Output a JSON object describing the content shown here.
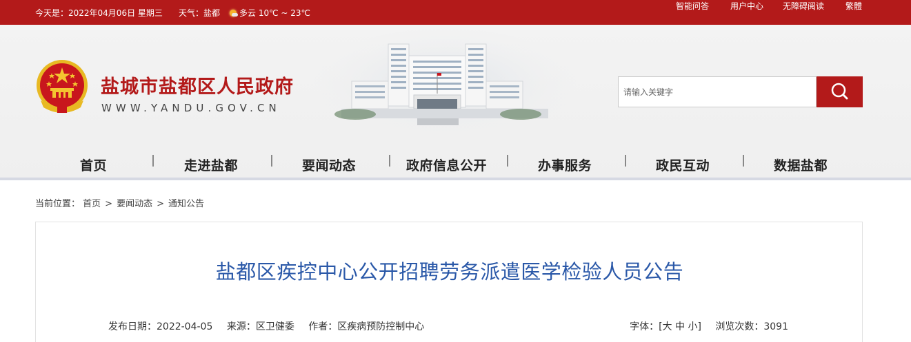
{
  "topbar": {
    "date": "今天是：2022年04月06日 星期三",
    "weather_label": "天气：盐都",
    "weather_text": "多云 10℃ ~ 23℃",
    "links": [
      "智能问答",
      "用户中心",
      "无障碍阅读",
      "繁體"
    ],
    "background_color": "#b31a1a"
  },
  "header": {
    "site_title": "盐城市盐都区人民政府",
    "site_domain": "WWW.YANDU.GOV.CN",
    "search_placeholder": "请输入关键字",
    "accent_color": "#b31a1a"
  },
  "nav": {
    "items": [
      "首页",
      "走进盐都",
      "要闻动态",
      "政府信息公开",
      "办事服务",
      "政民互动",
      "数据盐都"
    ]
  },
  "breadcrumb": {
    "label": "当前位置：",
    "items": [
      "首页",
      "要闻动态",
      "通知公告"
    ],
    "separator": ">"
  },
  "article": {
    "title": "盐都区疾控中心公开招聘劳务派遣医学检验人员公告",
    "publish_date": "发布日期：2022-04-05",
    "source": "来源：区卫健委",
    "author": "作者：区疾病预防控制中心",
    "font_label": "字体：",
    "font_sizes": "[大 中 小]",
    "views": "浏览次数：3091",
    "title_color": "#2a58a8"
  }
}
